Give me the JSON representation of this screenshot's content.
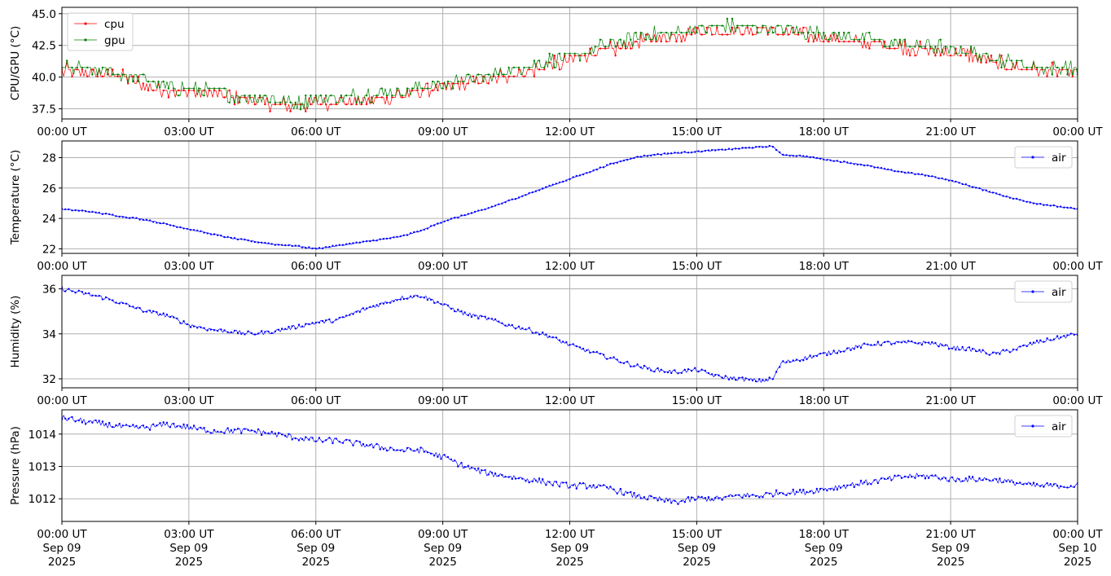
{
  "chart_data": [
    {
      "type": "line",
      "ylabel": "CPU/GPU (°C)",
      "ylim": [
        36.7,
        45.5
      ],
      "yticks": [
        37.5,
        40.0,
        42.5,
        45.0
      ],
      "ytick_labels": [
        "37.5",
        "40.0",
        "42.5",
        "45.0"
      ],
      "xlim": [
        "2025-09-09T00:00Z",
        "2025-09-10T00:00Z"
      ],
      "xtick_labels": [
        "00:00 UT",
        "03:00 UT",
        "06:00 UT",
        "09:00 UT",
        "12:00 UT",
        "15:00 UT",
        "18:00 UT",
        "21:00 UT",
        "00:00 UT"
      ],
      "grid": true,
      "legend": "top-left",
      "series": [
        {
          "name": "cpu",
          "color": "#ff0000",
          "x_hours": [
            0,
            1,
            1.5,
            2,
            2.5,
            3,
            3.5,
            4,
            4.5,
            5,
            5.5,
            6,
            6.5,
            7,
            7.5,
            8,
            8.5,
            9,
            9.5,
            10,
            10.5,
            11,
            11.5,
            12,
            12.5,
            13,
            13.5,
            14,
            14.5,
            15,
            15.5,
            16,
            16.5,
            17,
            17.5,
            18,
            18.5,
            19,
            19.5,
            20,
            20.5,
            21,
            21.5,
            22,
            22.5,
            23,
            23.5,
            24
          ],
          "values": [
            40.6,
            40.3,
            40.1,
            39.3,
            39.1,
            38.9,
            38.8,
            38.6,
            38.3,
            38.0,
            37.9,
            38.0,
            38.1,
            38.3,
            38.4,
            38.7,
            39.0,
            39.3,
            39.6,
            40.0,
            40.2,
            40.6,
            41.0,
            41.4,
            41.9,
            42.3,
            42.7,
            43.1,
            43.4,
            43.6,
            43.7,
            43.8,
            43.8,
            43.6,
            43.5,
            43.2,
            42.9,
            42.8,
            42.6,
            42.4,
            42.2,
            42.0,
            41.8,
            41.2,
            40.9,
            40.7,
            40.6,
            40.4
          ]
        },
        {
          "name": "gpu",
          "color": "#008000",
          "x_hours": [
            0,
            1,
            1.5,
            2,
            2.5,
            3,
            3.5,
            4,
            4.5,
            5,
            5.5,
            6,
            6.5,
            7,
            7.5,
            8,
            8.5,
            9,
            9.5,
            10,
            10.5,
            11,
            11.5,
            12,
            12.5,
            13,
            13.5,
            14,
            14.5,
            15,
            15.5,
            16,
            16.5,
            17,
            17.5,
            18,
            18.5,
            19,
            19.5,
            20,
            20.5,
            21,
            21.5,
            22,
            22.5,
            23,
            23.5,
            24
          ],
          "values": [
            40.7,
            40.4,
            40.2,
            39.6,
            39.2,
            39.0,
            38.9,
            38.6,
            38.3,
            38.2,
            38.0,
            38.1,
            38.3,
            38.5,
            38.7,
            38.8,
            39.2,
            39.4,
            39.8,
            40.1,
            40.4,
            40.8,
            41.2,
            41.6,
            42.0,
            42.6,
            43.0,
            43.3,
            43.5,
            43.7,
            43.9,
            44.0,
            43.9,
            43.8,
            43.5,
            43.3,
            43.1,
            42.9,
            42.7,
            42.5,
            42.4,
            42.2,
            41.9,
            41.4,
            41.1,
            40.8,
            40.7,
            40.6
          ]
        }
      ]
    },
    {
      "type": "line",
      "ylabel": "Temperature (°C)",
      "ylim": [
        21.7,
        29.1
      ],
      "yticks": [
        22,
        24,
        26,
        28
      ],
      "ytick_labels": [
        "22",
        "24",
        "26",
        "28"
      ],
      "xlim": [
        "2025-09-09T00:00Z",
        "2025-09-10T00:00Z"
      ],
      "xtick_labels": [
        "00:00 UT",
        "03:00 UT",
        "06:00 UT",
        "09:00 UT",
        "12:00 UT",
        "15:00 UT",
        "18:00 UT",
        "21:00 UT",
        "00:00 UT"
      ],
      "grid": true,
      "legend": "top-right",
      "series": [
        {
          "name": "air",
          "color": "#0000ff",
          "x_hours": [
            0,
            0.5,
            1,
            1.5,
            2,
            2.5,
            3,
            3.5,
            4,
            4.5,
            5,
            5.5,
            6,
            6.5,
            7,
            7.5,
            8,
            8.5,
            9,
            9.5,
            10,
            10.5,
            11,
            11.5,
            12,
            12.5,
            13,
            13.5,
            14,
            14.5,
            15,
            15.5,
            16,
            16.5,
            16.8,
            17,
            17.5,
            18,
            18.5,
            19,
            19.5,
            20,
            20.5,
            21,
            21.5,
            22,
            22.5,
            23,
            23.5,
            24
          ],
          "values": [
            24.6,
            24.5,
            24.3,
            24.1,
            23.9,
            23.6,
            23.3,
            23.0,
            22.7,
            22.5,
            22.3,
            22.2,
            22.0,
            22.2,
            22.4,
            22.6,
            22.8,
            23.2,
            23.8,
            24.2,
            24.6,
            25.1,
            25.6,
            26.1,
            26.6,
            27.1,
            27.6,
            28.0,
            28.2,
            28.3,
            28.4,
            28.5,
            28.6,
            28.7,
            28.75,
            28.2,
            28.1,
            27.9,
            27.7,
            27.5,
            27.2,
            27.0,
            26.8,
            26.5,
            26.1,
            25.7,
            25.3,
            25.0,
            24.8,
            24.6
          ]
        }
      ]
    },
    {
      "type": "line",
      "ylabel": "Humidity (%)",
      "ylim": [
        31.6,
        36.6
      ],
      "yticks": [
        32,
        34,
        36
      ],
      "ytick_labels": [
        "32",
        "34",
        "36"
      ],
      "xlim": [
        "2025-09-09T00:00Z",
        "2025-09-10T00:00Z"
      ],
      "xtick_labels": [
        "00:00 UT",
        "03:00 UT",
        "06:00 UT",
        "09:00 UT",
        "12:00 UT",
        "15:00 UT",
        "18:00 UT",
        "21:00 UT",
        "00:00 UT"
      ],
      "grid": true,
      "legend": "top-right",
      "series": [
        {
          "name": "air",
          "color": "#0000ff",
          "x_hours": [
            0,
            0.5,
            1,
            1.5,
            2,
            2.5,
            3,
            3.5,
            4,
            4.5,
            5,
            5.5,
            6,
            6.5,
            7,
            7.5,
            8,
            8.5,
            9,
            9.5,
            10,
            10.5,
            11,
            11.5,
            12,
            12.5,
            13,
            13.5,
            14,
            14.5,
            15,
            15.5,
            16,
            16.5,
            16.8,
            17,
            17.5,
            18,
            18.5,
            19,
            19.5,
            20,
            20.5,
            21,
            21.5,
            22,
            22.5,
            23,
            23.5,
            24
          ],
          "values": [
            36.0,
            35.8,
            35.6,
            35.3,
            35.0,
            34.8,
            34.4,
            34.2,
            34.1,
            34.0,
            34.1,
            34.3,
            34.5,
            34.6,
            35.0,
            35.3,
            35.6,
            35.7,
            35.3,
            34.9,
            34.7,
            34.4,
            34.2,
            33.9,
            33.5,
            33.2,
            32.9,
            32.6,
            32.4,
            32.3,
            32.4,
            32.1,
            32.0,
            31.9,
            32.0,
            32.7,
            32.9,
            33.1,
            33.3,
            33.5,
            33.6,
            33.6,
            33.6,
            33.4,
            33.3,
            33.1,
            33.3,
            33.6,
            33.8,
            34.0
          ]
        }
      ]
    },
    {
      "type": "line",
      "ylabel": "Pressure (hPa)",
      "ylim": [
        1011.3,
        1014.75
      ],
      "yticks": [
        1012,
        1013,
        1014
      ],
      "ytick_labels": [
        "1012",
        "1013",
        "1014"
      ],
      "xlim": [
        "2025-09-09T00:00Z",
        "2025-09-10T00:00Z"
      ],
      "xtick_labels": [
        "00:00 UT\nSep 09\n2025",
        "03:00 UT\nSep 09\n2025",
        "06:00 UT\nSep 09\n2025",
        "09:00 UT\nSep 09\n2025",
        "12:00 UT\nSep 09\n2025",
        "15:00 UT\nSep 09\n2025",
        "18:00 UT\nSep 09\n2025",
        "21:00 UT\nSep 09\n2025",
        "00:00 UT\nSep 10\n2025"
      ],
      "grid": true,
      "legend": "top-right",
      "series": [
        {
          "name": "air",
          "color": "#0000ff",
          "x_hours": [
            0,
            0.5,
            1,
            1.5,
            2,
            2.5,
            3,
            3.5,
            4,
            4.5,
            5,
            5.5,
            6,
            6.5,
            7,
            7.5,
            8,
            8.5,
            9,
            9.5,
            10,
            10.5,
            11,
            11.5,
            12,
            12.5,
            13,
            13.5,
            14,
            14.5,
            15,
            15.5,
            16,
            16.5,
            17,
            17.5,
            18,
            18.5,
            19,
            19.5,
            20,
            20.5,
            21,
            21.5,
            22,
            22.5,
            23,
            23.5,
            24
          ],
          "values": [
            1014.5,
            1014.4,
            1014.3,
            1014.2,
            1014.2,
            1014.3,
            1014.2,
            1014.1,
            1014.1,
            1014.1,
            1014.0,
            1013.9,
            1013.8,
            1013.8,
            1013.7,
            1013.6,
            1013.5,
            1013.5,
            1013.3,
            1013.0,
            1012.8,
            1012.7,
            1012.6,
            1012.5,
            1012.4,
            1012.4,
            1012.3,
            1012.1,
            1012.0,
            1011.9,
            1012.0,
            1012.0,
            1012.1,
            1012.1,
            1012.2,
            1012.2,
            1012.3,
            1012.4,
            1012.5,
            1012.6,
            1012.7,
            1012.7,
            1012.6,
            1012.6,
            1012.6,
            1012.5,
            1012.4,
            1012.4,
            1012.4
          ]
        }
      ]
    }
  ]
}
